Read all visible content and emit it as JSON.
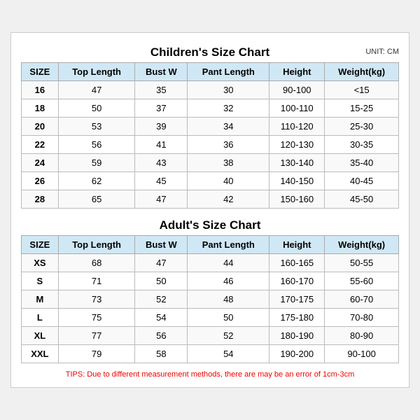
{
  "children_title": "Children's Size Chart",
  "adult_title": "Adult's Size Chart",
  "unit": "UNIT: CM",
  "columns": [
    "SIZE",
    "Top Length",
    "Bust W",
    "Pant Length",
    "Height",
    "Weight(kg)"
  ],
  "children_rows": [
    [
      "16",
      "47",
      "35",
      "30",
      "90-100",
      "<15"
    ],
    [
      "18",
      "50",
      "37",
      "32",
      "100-110",
      "15-25"
    ],
    [
      "20",
      "53",
      "39",
      "34",
      "110-120",
      "25-30"
    ],
    [
      "22",
      "56",
      "41",
      "36",
      "120-130",
      "30-35"
    ],
    [
      "24",
      "59",
      "43",
      "38",
      "130-140",
      "35-40"
    ],
    [
      "26",
      "62",
      "45",
      "40",
      "140-150",
      "40-45"
    ],
    [
      "28",
      "65",
      "47",
      "42",
      "150-160",
      "45-50"
    ]
  ],
  "adult_rows": [
    [
      "XS",
      "68",
      "47",
      "44",
      "160-165",
      "50-55"
    ],
    [
      "S",
      "71",
      "50",
      "46",
      "160-170",
      "55-60"
    ],
    [
      "M",
      "73",
      "52",
      "48",
      "170-175",
      "60-70"
    ],
    [
      "L",
      "75",
      "54",
      "50",
      "175-180",
      "70-80"
    ],
    [
      "XL",
      "77",
      "56",
      "52",
      "180-190",
      "80-90"
    ],
    [
      "XXL",
      "79",
      "58",
      "54",
      "190-200",
      "90-100"
    ]
  ],
  "tips": "TIPS: Due to different measurement methods, there are may be an error of 1cm-3cm"
}
